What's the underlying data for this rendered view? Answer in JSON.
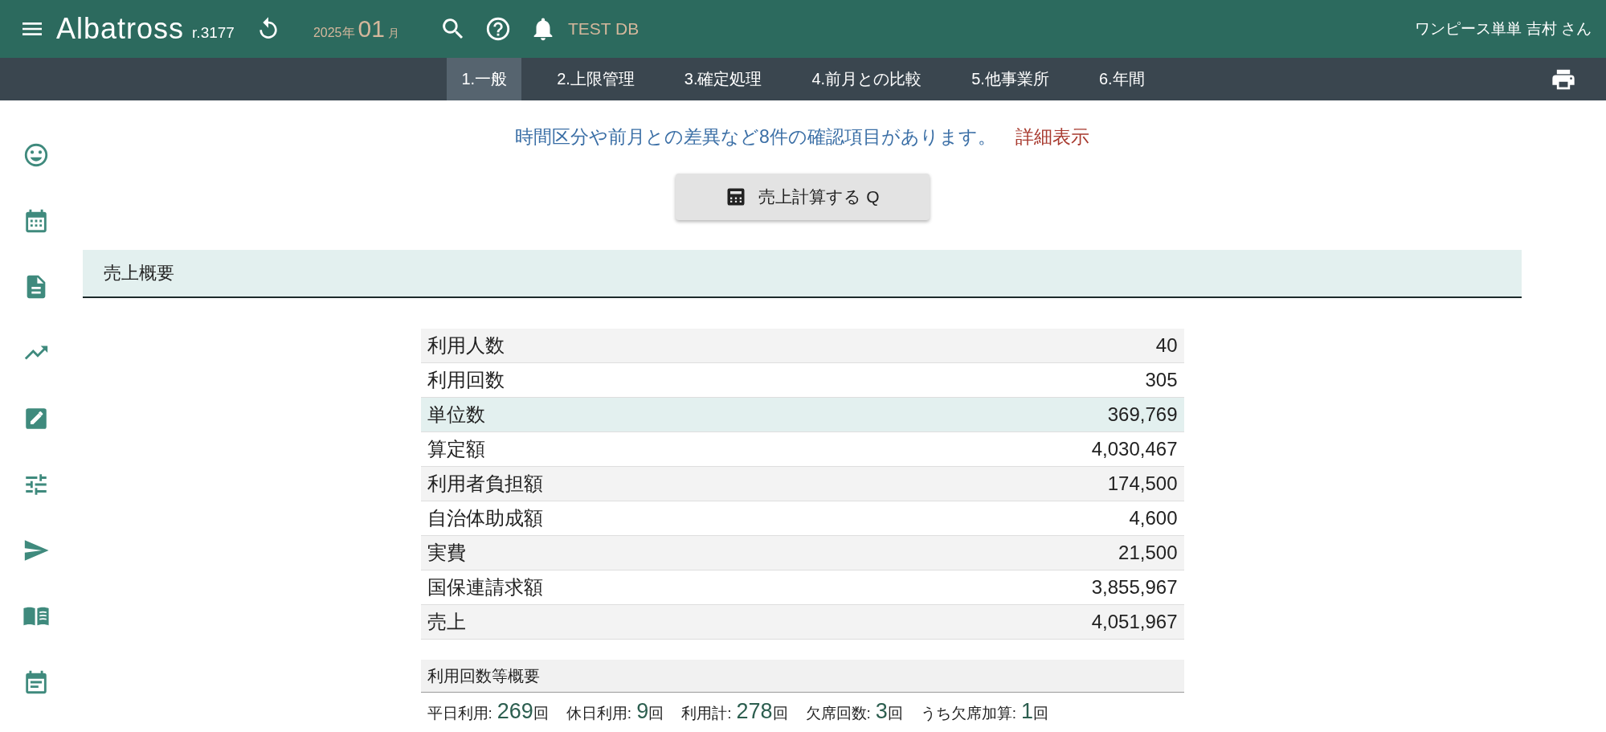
{
  "header": {
    "app_name": "Albatross",
    "revision": "r.3177",
    "year": "2025年",
    "month": "01",
    "month_unit": "月",
    "db_label": "TEST DB",
    "user": "ワンピース単単 吉村 さん"
  },
  "tabs": [
    {
      "label": "1.一般",
      "selected": true
    },
    {
      "label": "2.上限管理",
      "selected": false
    },
    {
      "label": "3.確定処理",
      "selected": false
    },
    {
      "label": "4.前月との比較",
      "selected": false
    },
    {
      "label": "5.他事業所",
      "selected": false
    },
    {
      "label": "6.年間",
      "selected": false
    }
  ],
  "sidebar": {
    "items": [
      {
        "kind": "smiley"
      },
      {
        "kind": "calendar"
      },
      {
        "kind": "document"
      },
      {
        "kind": "trend"
      },
      {
        "kind": "edit"
      },
      {
        "kind": "tune"
      },
      {
        "kind": "send"
      },
      {
        "kind": "book"
      },
      {
        "kind": "event"
      }
    ]
  },
  "notice": {
    "message": "時間区分や前月との差異など8件の確認項目があります。",
    "link": "詳細表示"
  },
  "calc_button": "売上計算する Q",
  "section_title": "売上概要",
  "summary_rows": [
    {
      "label": "利用人数",
      "value": "40",
      "highlighted": false
    },
    {
      "label": "利用回数",
      "value": "305",
      "highlighted": false
    },
    {
      "label": "単位数",
      "value": "369,769",
      "highlighted": true
    },
    {
      "label": "算定額",
      "value": "4,030,467",
      "highlighted": false
    },
    {
      "label": "利用者負担額",
      "value": "174,500",
      "highlighted": false
    },
    {
      "label": "自治体助成額",
      "value": "4,600",
      "highlighted": false
    },
    {
      "label": "実費",
      "value": "21,500",
      "highlighted": false
    },
    {
      "label": "国保連請求額",
      "value": "3,855,967",
      "highlighted": false
    },
    {
      "label": "売上",
      "value": "4,051,967",
      "highlighted": false
    }
  ],
  "usage": {
    "title": "利用回数等概要",
    "stats": [
      {
        "label": "平日利用:",
        "value": "269",
        "unit": "回"
      },
      {
        "label": "休日利用:",
        "value": "9",
        "unit": "回"
      },
      {
        "label": "利用計:",
        "value": "278",
        "unit": "回"
      },
      {
        "label": "欠席回数:",
        "value": "3",
        "unit": "回"
      },
      {
        "label": "うち欠席加算:",
        "value": "1",
        "unit": "回"
      }
    ]
  }
}
